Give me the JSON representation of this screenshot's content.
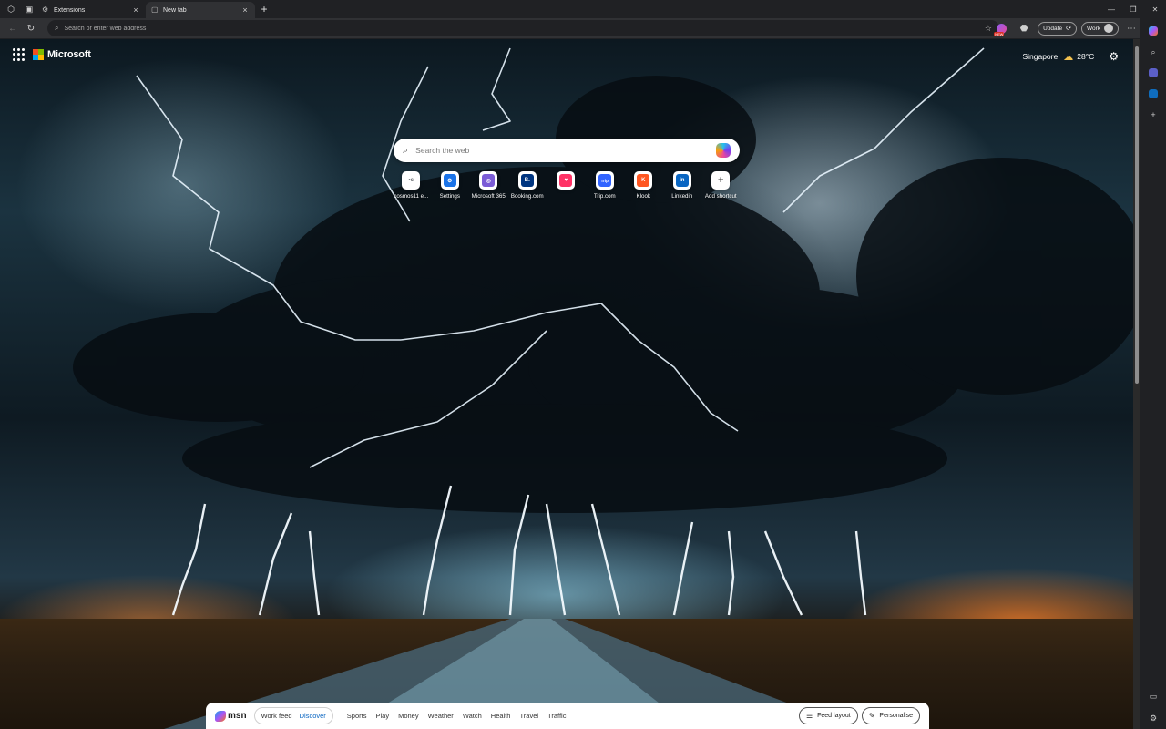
{
  "browser": {
    "tabs": [
      {
        "title": "Extensions",
        "active": false
      },
      {
        "title": "New tab",
        "active": true
      }
    ],
    "address_placeholder": "Search or enter web address",
    "ext_badge": "NEW",
    "update_label": "Update",
    "profile_label": "Work"
  },
  "ntp": {
    "brand": "Microsoft",
    "location": "Singapore",
    "temperature": "28°C",
    "search_placeholder": "Search the web",
    "quick_links": [
      {
        "label": "cosmos11 e...",
        "glyph": "•c",
        "color": "#5f6368"
      },
      {
        "label": "Settings",
        "glyph": "⚙",
        "color": "#1a73e8"
      },
      {
        "label": "Microsoft 365",
        "glyph": "◎",
        "color": "#7b5cd6"
      },
      {
        "label": "Booking.com",
        "glyph": "B.",
        "color": "#003580"
      },
      {
        "label": "",
        "glyph": "♥",
        "color": "#ff3366"
      },
      {
        "label": "Trip.com",
        "glyph": "Trip",
        "color": "#3264ff"
      },
      {
        "label": "Klook",
        "glyph": "K",
        "color": "#ff5722"
      },
      {
        "label": "Linkedin",
        "glyph": "in",
        "color": "#0a66c2"
      },
      {
        "label": "Add shortcut",
        "glyph": "+",
        "color": "#ffffff"
      }
    ]
  },
  "msn": {
    "logo": "msn",
    "feed_modes": [
      "Work feed",
      "Discover"
    ],
    "nav": [
      "Sports",
      "Play",
      "Money",
      "Weather",
      "Watch",
      "Health",
      "Travel",
      "Traffic"
    ],
    "feed_layout_label": "Feed layout",
    "personalise_label": "Personalise"
  }
}
